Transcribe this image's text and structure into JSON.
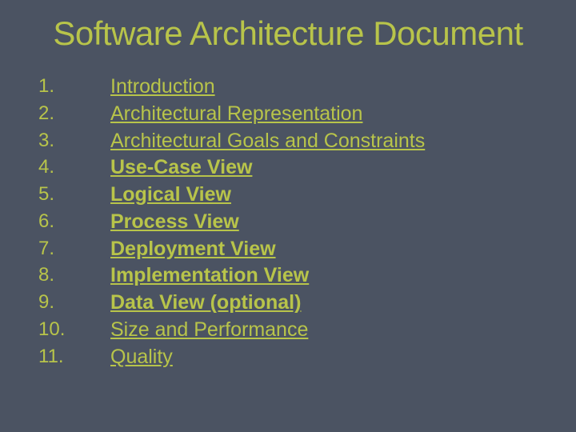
{
  "title": "Software Architecture Document",
  "items": [
    {
      "label": "Introduction",
      "bold": false
    },
    {
      "label": "Architectural Representation",
      "bold": false
    },
    {
      "label": "Architectural Goals and Constraints",
      "bold": false
    },
    {
      "label": "Use-Case View",
      "bold": true
    },
    {
      "label": "Logical View",
      "bold": true
    },
    {
      "label": "Process View",
      "bold": true
    },
    {
      "label": "Deployment View",
      "bold": true
    },
    {
      "label": "Implementation View",
      "bold": true
    },
    {
      "label": "Data View (optional)",
      "bold": true
    },
    {
      "label": "Size and Performance",
      "bold": false
    },
    {
      "label": "Quality",
      "bold": false
    }
  ]
}
